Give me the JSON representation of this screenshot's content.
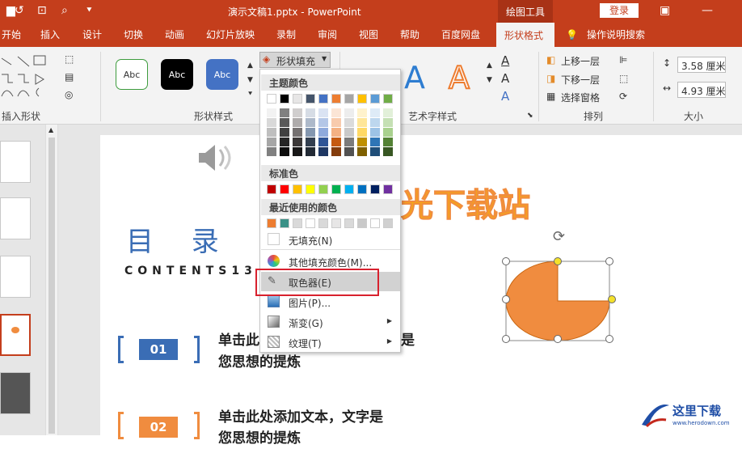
{
  "titlebar": {
    "title": "演示文稿1.pptx  -  PowerPoint",
    "context_tab": "绘图工具",
    "login": "登录"
  },
  "tabs": [
    "开始",
    "插入",
    "设计",
    "切换",
    "动画",
    "幻灯片放映",
    "录制",
    "审阅",
    "视图",
    "帮助",
    "百度网盘",
    "形状格式",
    "操作说明搜索"
  ],
  "ribbon": {
    "insert_shapes": "插入形状",
    "shape_styles": "形状样式",
    "abc_label": "Abc",
    "fill_button": "形状填充",
    "wordart": "艺术字样式",
    "arrange": "排列",
    "bring_forward": "上移一层",
    "send_backward": "下移一层",
    "selection_pane": "选择窗格",
    "size": "大小",
    "height": "3.58 厘米",
    "width": "4.93 厘米",
    "text_a": "A"
  },
  "menu": {
    "theme_colors": "主题颜色",
    "standard_colors": "标准色",
    "recent_colors": "最近使用的颜色",
    "no_fill": "无填充(N)",
    "more_colors": "其他填充颜色(M)...",
    "eyedropper": "取色器(E)",
    "picture": "图片(P)...",
    "gradient": "渐变(G)",
    "texture": "纹理(T)"
  },
  "colors": {
    "theme_top": [
      "#ffffff",
      "#000000",
      "#e7e6e6",
      "#44546a",
      "#4472c4",
      "#ed7d31",
      "#a5a5a5",
      "#ffc000",
      "#5b9bd5",
      "#70ad47"
    ],
    "standard": [
      "#c00000",
      "#ff0000",
      "#ffc000",
      "#ffff00",
      "#92d050",
      "#00b050",
      "#00b0f0",
      "#0070c0",
      "#002060",
      "#7030a0"
    ],
    "recent": [
      "#ed7d31",
      "#3a9086",
      "#d9d9d9",
      "#ffffff",
      "#d9d9d9",
      "#e7e6e6",
      "#d9d9d9",
      "#c9c9c9",
      "#ffffff",
      "#d0d0d0"
    ],
    "accent": "#c43e1c",
    "shape_fill": "#f08c3f"
  },
  "slide": {
    "title": "目 录",
    "contents": "CONTENTS13",
    "watermark": "光下载站",
    "item1_num": "01",
    "item1_line1": "单击此",
    "item1_line1b": "是",
    "item1_line2": "您思想的提炼",
    "item2_num": "02",
    "item2_line1": "单击此处添加文本，文字是",
    "item2_line2": "您思想的提炼",
    "logo": "这里下载",
    "logo_url": "www.herodown.com"
  }
}
